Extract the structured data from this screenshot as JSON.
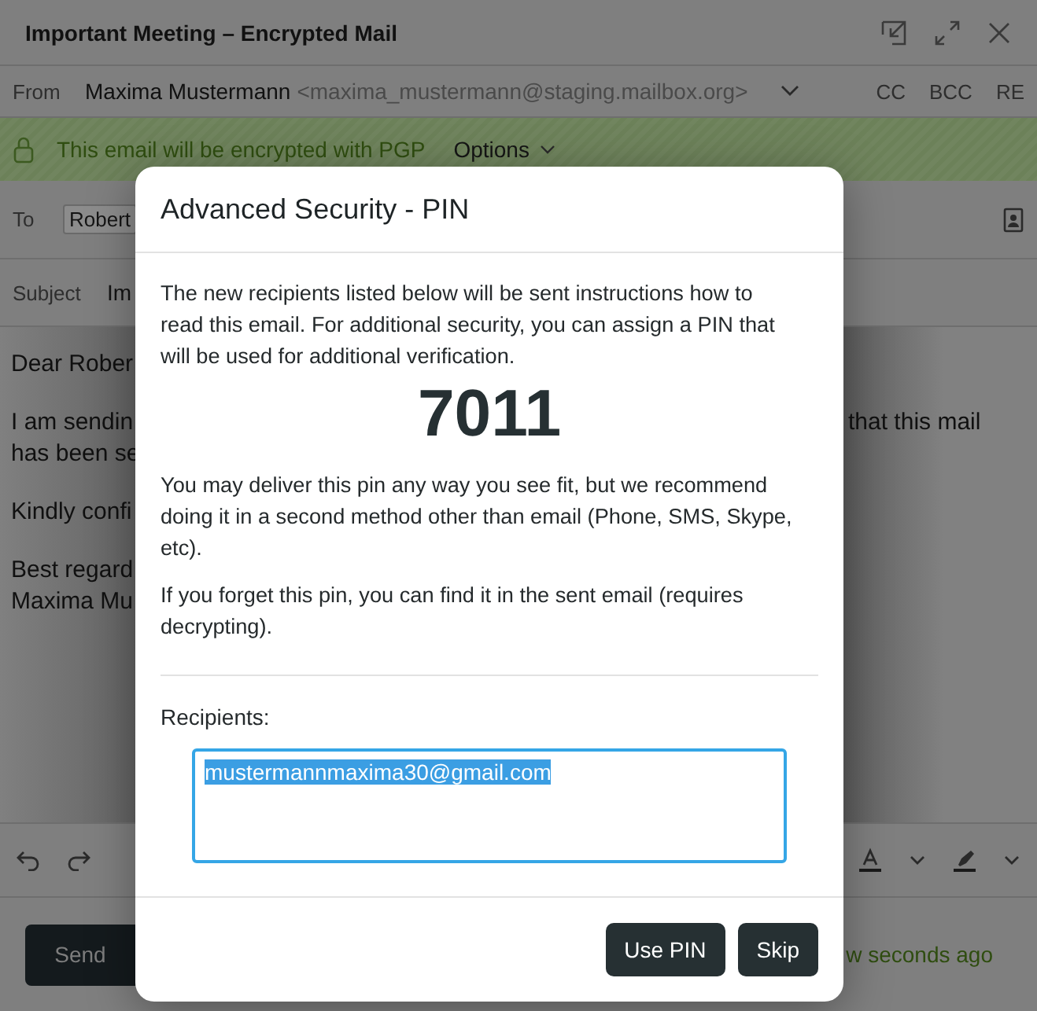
{
  "window": {
    "title": "Important Meeting – Encrypted Mail"
  },
  "from": {
    "label": "From",
    "name": "Maxima Mustermann",
    "address": "<maxima_mustermann@staging.mailbox.org>",
    "links": [
      "CC",
      "BCC",
      "RE"
    ]
  },
  "encryption_banner": {
    "text": "This email will be encrypted with PGP",
    "options": "Options"
  },
  "to": {
    "label": "To",
    "recipients": [
      "Robert"
    ]
  },
  "subject": {
    "label": "Subject",
    "value": "Im"
  },
  "body": {
    "paragraphs": [
      {
        "lines": [
          {
            "left": "Dear Rober"
          }
        ]
      },
      {
        "lines": [
          {
            "left": "I am sendin",
            "right": "that this mail"
          },
          {
            "left": "has been se"
          }
        ]
      },
      {
        "lines": [
          {
            "left": "Kindly confi"
          }
        ]
      },
      {
        "lines": [
          {
            "left": "Best regard"
          },
          {
            "left": "Maxima Mu"
          }
        ]
      }
    ]
  },
  "footer": {
    "send": "Send",
    "status": "w seconds ago"
  },
  "dialog": {
    "title": "Advanced Security - PIN",
    "intro": "The new recipients listed below will be sent instructions how to read this email. For additional security, you can assign a PIN that will be used for additional verification.",
    "pin": "7011",
    "paragraphs": [
      "You may deliver this pin any way you see fit, but we recommend doing it in a second method other than email (Phone, SMS, Skype, etc).",
      "If you forget this pin, you can find it in the sent email (requires decrypting)."
    ],
    "recipients_label": "Recipients:",
    "recipients_value": "mustermannmaxima30@gmail.com",
    "buttons": [
      "Use PIN",
      "Skip"
    ]
  }
}
